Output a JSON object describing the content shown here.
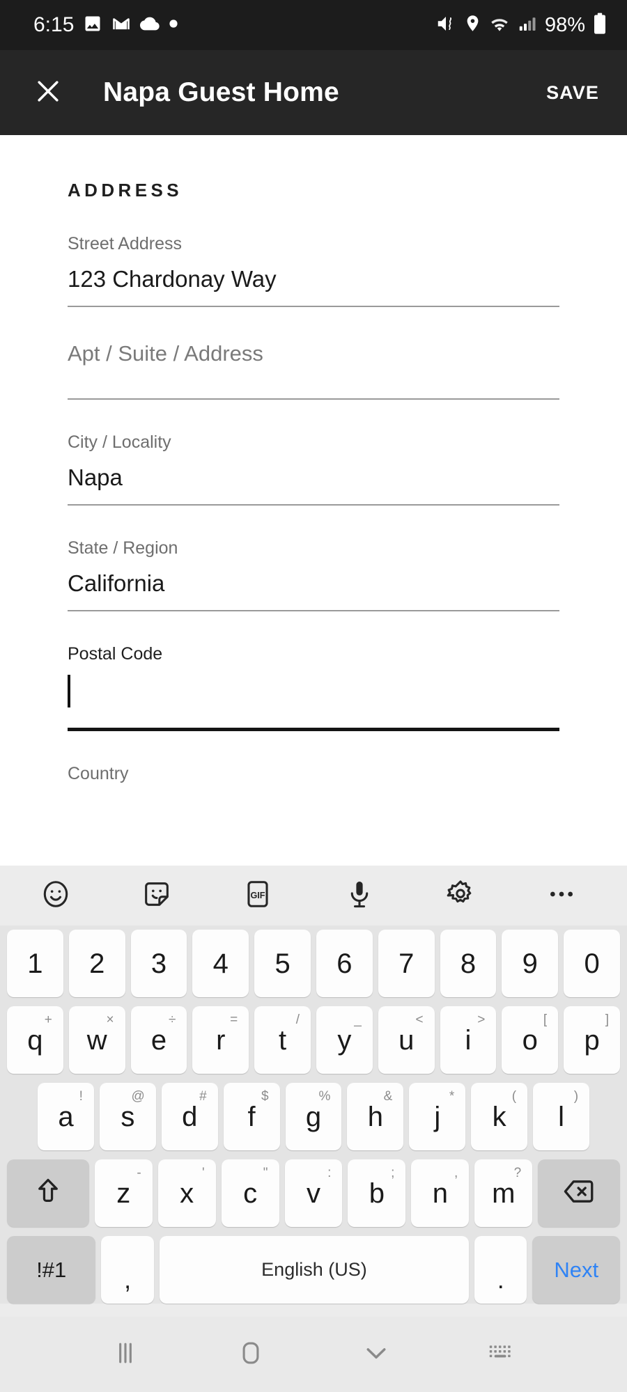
{
  "status_bar": {
    "clock": "6:15",
    "battery_percent": "98%",
    "left_icons": [
      "photo-icon",
      "gmail-icon",
      "cloud-icon",
      "dot-indicator-icon"
    ],
    "right_icons": [
      "mute-vibrate-icon",
      "location-icon",
      "wifi-icon",
      "cellular-signal-icon",
      "battery-icon"
    ],
    "background_color": "#1c1c1c"
  },
  "app_bar": {
    "close_label": "close-icon",
    "title": "Napa Guest Home",
    "save_label": "SAVE",
    "background_color": "#262626"
  },
  "form": {
    "section_title": "ADDRESS",
    "fields": [
      {
        "name": "street-address",
        "label": "Street Address",
        "value": "123 Chardonay Way",
        "placeholder": "Street Address",
        "focused": false,
        "empty": false
      },
      {
        "name": "apt-suite-address",
        "label": "",
        "value": "",
        "placeholder": "Apt / Suite / Address",
        "focused": false,
        "empty": true
      },
      {
        "name": "city-locality",
        "label": "City / Locality",
        "value": "Napa",
        "placeholder": "City / Locality",
        "focused": false,
        "empty": false
      },
      {
        "name": "state-region",
        "label": "State / Region",
        "value": "California",
        "placeholder": "State / Region",
        "focused": false,
        "empty": false
      },
      {
        "name": "postal-code",
        "label": "Postal Code",
        "value": "",
        "placeholder": "Postal Code",
        "focused": true,
        "empty": true
      },
      {
        "name": "country",
        "label": "",
        "value": "",
        "placeholder": "Country",
        "focused": false,
        "empty": true
      }
    ]
  },
  "keyboard": {
    "toolbar_icons": [
      "emoji-icon",
      "sticker-icon",
      "gif-icon",
      "microphone-icon",
      "gear-icon",
      "overflow-menu-icon"
    ],
    "gif_label": "GIF",
    "rows": [
      {
        "name": "number-row",
        "keys": [
          {
            "main": "1",
            "sup": ""
          },
          {
            "main": "2",
            "sup": ""
          },
          {
            "main": "3",
            "sup": ""
          },
          {
            "main": "4",
            "sup": ""
          },
          {
            "main": "5",
            "sup": ""
          },
          {
            "main": "6",
            "sup": ""
          },
          {
            "main": "7",
            "sup": ""
          },
          {
            "main": "8",
            "sup": ""
          },
          {
            "main": "9",
            "sup": ""
          },
          {
            "main": "0",
            "sup": ""
          }
        ]
      },
      {
        "name": "qwerty-row",
        "keys": [
          {
            "main": "q",
            "sup": "+"
          },
          {
            "main": "w",
            "sup": "×"
          },
          {
            "main": "e",
            "sup": "÷"
          },
          {
            "main": "r",
            "sup": "="
          },
          {
            "main": "t",
            "sup": "/"
          },
          {
            "main": "y",
            "sup": "_"
          },
          {
            "main": "u",
            "sup": "<"
          },
          {
            "main": "i",
            "sup": ">"
          },
          {
            "main": "o",
            "sup": "["
          },
          {
            "main": "p",
            "sup": "]"
          }
        ]
      },
      {
        "name": "asdf-row",
        "keys": [
          {
            "main": "a",
            "sup": "!"
          },
          {
            "main": "s",
            "sup": "@"
          },
          {
            "main": "d",
            "sup": "#"
          },
          {
            "main": "f",
            "sup": "$"
          },
          {
            "main": "g",
            "sup": "%"
          },
          {
            "main": "h",
            "sup": "&"
          },
          {
            "main": "j",
            "sup": "*"
          },
          {
            "main": "k",
            "sup": "("
          },
          {
            "main": "l",
            "sup": ")"
          }
        ]
      },
      {
        "name": "zxcv-row",
        "keys": [
          {
            "main": "z",
            "sup": "-"
          },
          {
            "main": "x",
            "sup": "'"
          },
          {
            "main": "c",
            "sup": "\""
          },
          {
            "main": "v",
            "sup": ":"
          },
          {
            "main": "b",
            "sup": ";"
          },
          {
            "main": "n",
            "sup": ","
          },
          {
            "main": "m",
            "sup": "?"
          }
        ]
      }
    ],
    "shift_icon": "shift-arrow-icon",
    "backspace_icon": "backspace-icon",
    "symbols_label": "!#1",
    "comma_label": ",",
    "space_label": "English (US)",
    "period_label": ".",
    "next_label": "Next",
    "next_color": "#2f83f5",
    "key_bg": "#fdfdfd",
    "modifier_bg": "#cccccc",
    "keyboard_bg": "#e4e4e4",
    "toolbar_bg": "#ececec"
  },
  "nav_bar": {
    "buttons": [
      "recents-icon",
      "home-icon",
      "keyboard-dismiss-icon",
      "keyboard-switch-icon"
    ],
    "background_color": "#e9e9e9"
  }
}
